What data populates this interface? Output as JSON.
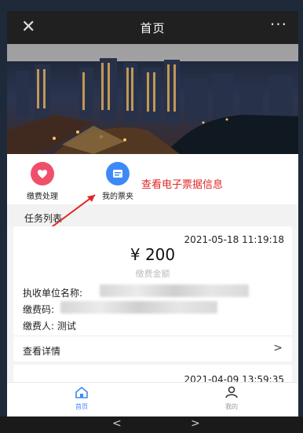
{
  "header": {
    "title": "首页",
    "close_icon": "close-icon",
    "more_label": "···"
  },
  "quick_actions": [
    {
      "label": "缴费处理",
      "icon": "payment-heart-icon",
      "color": "#ef4f6a"
    },
    {
      "label": "我的票夹",
      "icon": "ticket-folder-icon",
      "color": "#3d8af7"
    }
  ],
  "annotation": "查看电子票据信息",
  "section_title": "任务列表",
  "tasks": [
    {
      "date": "2021-05-18 11:19:18",
      "amount": "¥ 200",
      "amount_label": "缴费金额",
      "org_label": "执收单位名称:",
      "code_label": "缴费码:",
      "payer_label": "缴费人: 测试",
      "detail_label": "查看详情"
    },
    {
      "date": "2021-04-09 13:59:35"
    }
  ],
  "tabbar": [
    {
      "label": "首页",
      "icon": "home-icon",
      "active": true
    },
    {
      "label": "我的",
      "icon": "user-icon",
      "active": false
    }
  ],
  "nav": {
    "back": "<",
    "forward": ">"
  },
  "colors": {
    "topbar": "#202020",
    "accent": "#3d8af7",
    "annotation": "#e02525"
  }
}
